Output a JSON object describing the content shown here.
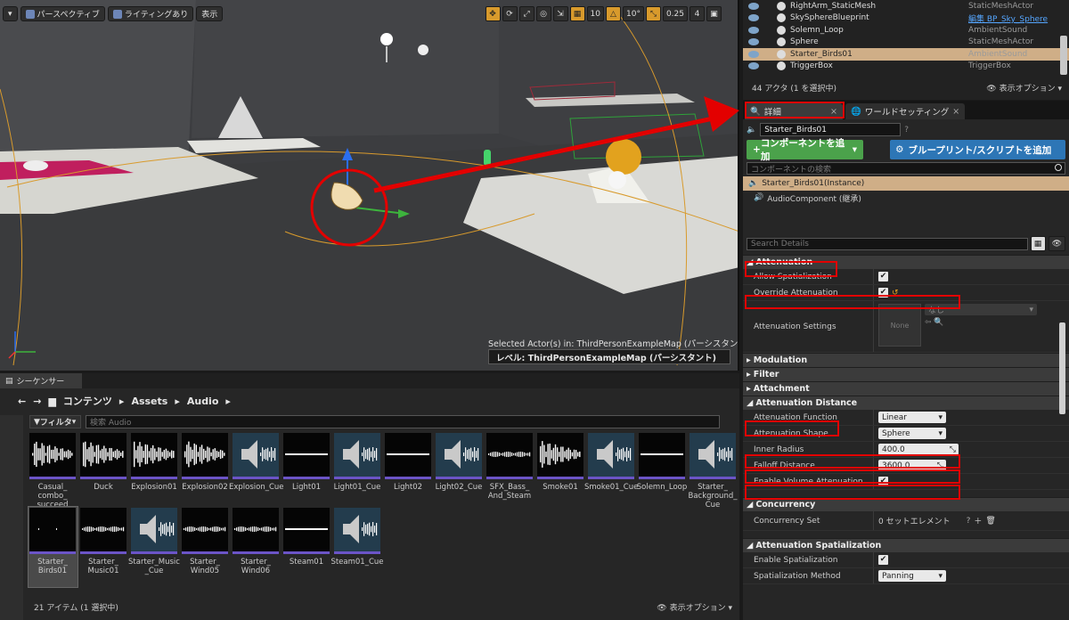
{
  "viewport": {
    "perspective_label": "パースペクティブ",
    "lighting_label": "ライティングあり",
    "show_label": "表示",
    "grid_snap": "10",
    "rotate_snap": "10°",
    "scale_snap": "0.25",
    "camera_speed": "4",
    "selected_actor_text": "Selected Actor(s) in:  ThirdPersonExampleMap (パーシスタント)",
    "level_text": "レベル:  ThirdPersonExampleMap (パーシスタント)"
  },
  "outliner": {
    "rows": [
      {
        "name": "RightArm_StaticMesh",
        "type": "StaticMeshActor"
      },
      {
        "name": "SkySphereBlueprint",
        "type": "編集 BP_Sky_Sphere",
        "link": true
      },
      {
        "name": "Solemn_Loop",
        "type": "AmbientSound"
      },
      {
        "name": "Sphere",
        "type": "StaticMeshActor"
      },
      {
        "name": "Starter_Birds01",
        "type": "AmbientSound",
        "selected": true
      },
      {
        "name": "TriggerBox",
        "type": "TriggerBox"
      }
    ],
    "footer": "44 アクタ (1 を選択中)",
    "view_options": "表示オプション"
  },
  "details": {
    "tab_details": "詳細",
    "tab_world": "ワールドセッティング",
    "actor_name": "Starter_Birds01",
    "add_component": "コンポーネントを追加",
    "blueprint_button": "ブループリント/スクリプトを追加",
    "component_search_placeholder": "コンポーネントの検索",
    "components": [
      "Starter_Birds01(Instance)",
      "AudioComponent (継承)"
    ],
    "search_details_placeholder": "Search Details",
    "attenuation": {
      "title": "Attenuation",
      "allow_spatialization": "Allow Spatialization",
      "override_attenuation": "Override Attenuation",
      "attenuation_settings": "Attenuation Settings",
      "thumb_none": "None",
      "settings_value": "なし"
    },
    "modulation": "Modulation",
    "filter": "Filter",
    "attachment": "Attachment",
    "attenuation_distance": {
      "title": "Attenuation Distance",
      "function_label": "Attenuation Function",
      "function_value": "Linear",
      "shape_label": "Attenuation Shape",
      "shape_value": "Sphere",
      "inner_label": "Inner Radius",
      "inner_value": "400.0",
      "falloff_label": "Falloff Distance",
      "falloff_value": "3600.0",
      "volume_label": "Enable Volume Attenuation"
    },
    "concurrency": {
      "title": "Concurrency",
      "set_label": "Concurrency Set",
      "set_value": "0 セットエレメント"
    },
    "spatialization": {
      "title": "Attenuation Spatialization",
      "enable_label": "Enable Spatialization",
      "method_label": "Spatialization Method",
      "method_value": "Panning"
    }
  },
  "content_browser": {
    "tab_label": "シーケンサー",
    "crumbs": [
      "コンテンツ",
      "Assets",
      "Audio"
    ],
    "filter_label": "フィルタ",
    "search_placeholder": "検索 Audio",
    "assets": [
      {
        "label": "Casual_\ncombo_\nsucceed",
        "kind": "wave"
      },
      {
        "label": "Duck",
        "kind": "wave"
      },
      {
        "label": "Explosion01",
        "kind": "wave"
      },
      {
        "label": "Explosion02",
        "kind": "wave"
      },
      {
        "label": "Explosion_Cue",
        "kind": "speaker"
      },
      {
        "label": "Light01",
        "kind": "flat"
      },
      {
        "label": "Light01_Cue",
        "kind": "speaker"
      },
      {
        "label": "Light02",
        "kind": "flat"
      },
      {
        "label": "Light02_Cue",
        "kind": "speaker"
      },
      {
        "label": "SFX_Bass_\nAnd_Steam",
        "kind": "noise"
      },
      {
        "label": "Smoke01",
        "kind": "wave"
      },
      {
        "label": "Smoke01_Cue",
        "kind": "speaker"
      },
      {
        "label": "Solemn_Loop",
        "kind": "flat"
      },
      {
        "label": "Starter_\nBackground_\nCue",
        "kind": "speaker"
      },
      {
        "label": "Starter_\nBirds01",
        "kind": "dots",
        "selected": true
      },
      {
        "label": "Starter_\nMusic01",
        "kind": "noise"
      },
      {
        "label": "Starter_Music\n_Cue",
        "kind": "speaker"
      },
      {
        "label": "Starter_\nWind05",
        "kind": "noise"
      },
      {
        "label": "Starter_\nWind06",
        "kind": "noise"
      },
      {
        "label": "Steam01",
        "kind": "flat"
      },
      {
        "label": "Steam01_Cue",
        "kind": "speaker"
      }
    ],
    "footer": "21 アイテム (1 選択中)",
    "view_options": "表示オプション"
  }
}
